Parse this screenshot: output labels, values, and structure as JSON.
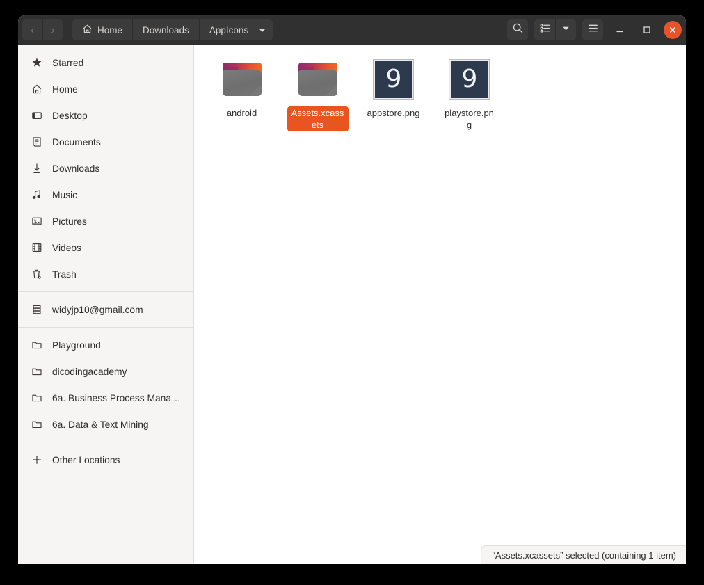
{
  "window": {
    "title": "AppIcons"
  },
  "header": {
    "nav": {
      "back_label": "‹",
      "forward_label": "›"
    },
    "breadcrumbs": [
      {
        "label": "Home",
        "icon": "home-icon",
        "has_menu": false
      },
      {
        "label": "Downloads",
        "icon": "",
        "has_menu": false
      },
      {
        "label": "AppIcons",
        "icon": "",
        "has_menu": true
      }
    ],
    "tools": [
      {
        "name": "search-icon",
        "label": ""
      },
      {
        "name": "view-list-icon",
        "label": ""
      },
      {
        "name": "view-options-chevron-icon",
        "label": ""
      },
      {
        "name": "hamburger-menu-icon",
        "label": ""
      }
    ],
    "window_controls": {
      "minimize": "–",
      "maximize": "□",
      "close": "×"
    }
  },
  "sidebar": {
    "groups": [
      {
        "items": [
          {
            "label": "Starred",
            "icon": "star-icon"
          },
          {
            "label": "Home",
            "icon": "home-icon"
          },
          {
            "label": "Desktop",
            "icon": "desktop-icon"
          },
          {
            "label": "Documents",
            "icon": "documents-icon"
          },
          {
            "label": "Downloads",
            "icon": "download-icon"
          },
          {
            "label": "Music",
            "icon": "music-note-icon"
          },
          {
            "label": "Pictures",
            "icon": "picture-icon"
          },
          {
            "label": "Videos",
            "icon": "video-icon"
          },
          {
            "label": "Trash",
            "icon": "trash-icon"
          }
        ]
      },
      {
        "items": [
          {
            "label": "widyjp10@gmail.com",
            "icon": "server-icon"
          }
        ]
      },
      {
        "items": [
          {
            "label": "Playground",
            "icon": "folder-icon"
          },
          {
            "label": "dicodingacademy",
            "icon": "folder-icon"
          },
          {
            "label": "6a. Business Process Mana…",
            "icon": "folder-icon"
          },
          {
            "label": "6a. Data & Text Mining",
            "icon": "folder-icon"
          }
        ]
      },
      {
        "items": [
          {
            "label": "Other Locations",
            "icon": "plus-icon"
          }
        ]
      }
    ]
  },
  "content": {
    "files": [
      {
        "name": "android",
        "type": "folder",
        "selected": false,
        "thumb_text": ""
      },
      {
        "name": "Assets.xcassets",
        "type": "folder",
        "selected": true,
        "thumb_text": ""
      },
      {
        "name": "appstore.png",
        "type": "image",
        "selected": false,
        "thumb_text": "9"
      },
      {
        "name": "playstore.png",
        "type": "image",
        "selected": false,
        "thumb_text": "9"
      }
    ]
  },
  "statusbar": {
    "text": "“Assets.xcassets” selected  (containing 1 item)"
  },
  "colors": {
    "accent": "#e95420",
    "headerbar": "#303030",
    "sidebar_bg": "#f6f5f4",
    "close_button": "#e8532a",
    "png_thumb_bg": "#2d3a4d"
  }
}
